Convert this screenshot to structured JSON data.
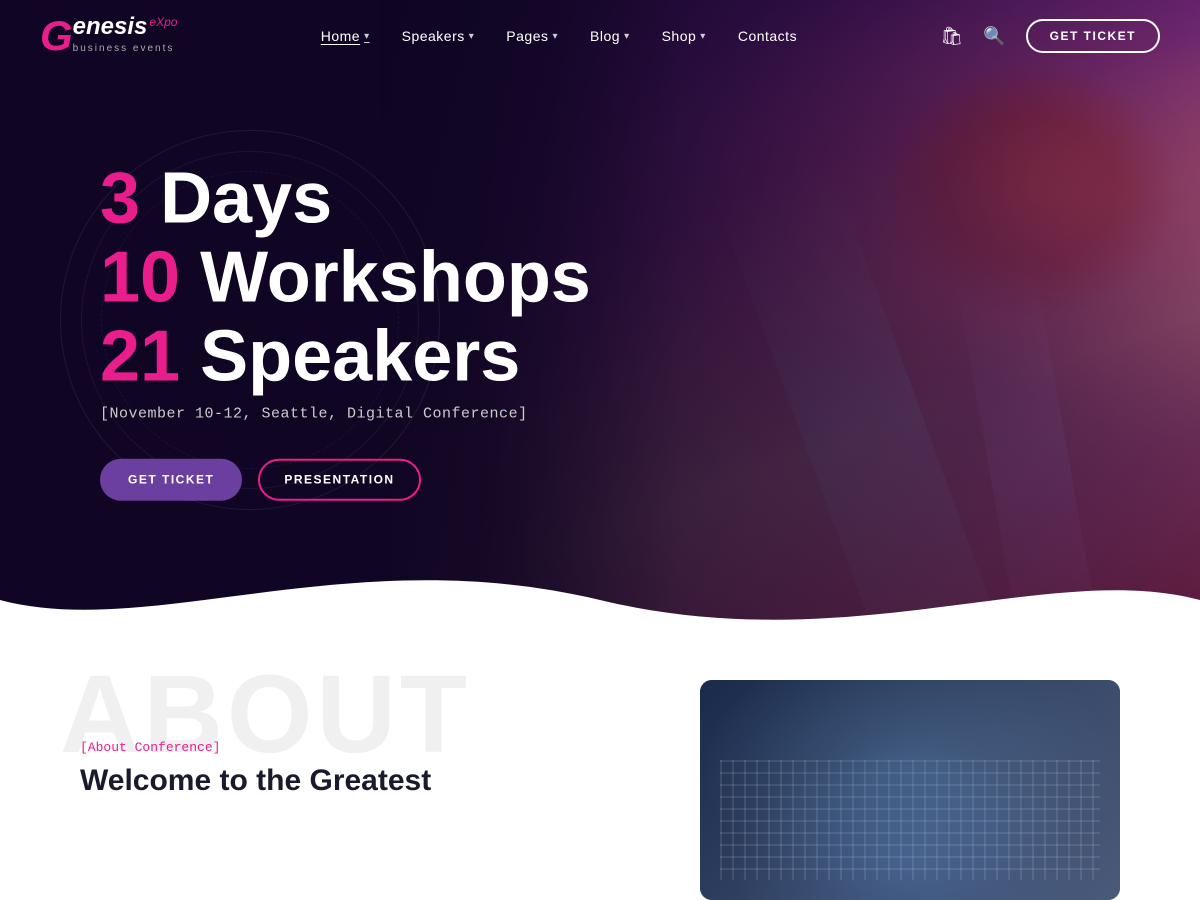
{
  "brand": {
    "logo_g": "G",
    "logo_rest": "enesis",
    "logo_expo": "eXpo",
    "logo_sub": "business events"
  },
  "nav": {
    "links": [
      {
        "label": "Home",
        "hasDropdown": true,
        "active": true
      },
      {
        "label": "Speakers",
        "hasDropdown": true,
        "active": false
      },
      {
        "label": "Pages",
        "hasDropdown": true,
        "active": false
      },
      {
        "label": "Blog",
        "hasDropdown": true,
        "active": false
      },
      {
        "label": "Shop",
        "hasDropdown": true,
        "active": false
      },
      {
        "label": "Contacts",
        "hasDropdown": false,
        "active": false
      }
    ],
    "cta_label": "GET TICKET"
  },
  "hero": {
    "line1_num": "3",
    "line1_text": "Days",
    "line2_num": "10",
    "line2_text": "Workshops",
    "line3_num": "21",
    "line3_text": "Speakers",
    "tagline": "[November 10-12, Seattle, Digital Conference]",
    "btn_ticket": "GET TICKET",
    "btn_presentation": "PRESENTATION"
  },
  "about": {
    "bg_text": "ABOUT",
    "label": "[About Conference]",
    "title": "Welcome to the Greatest"
  }
}
